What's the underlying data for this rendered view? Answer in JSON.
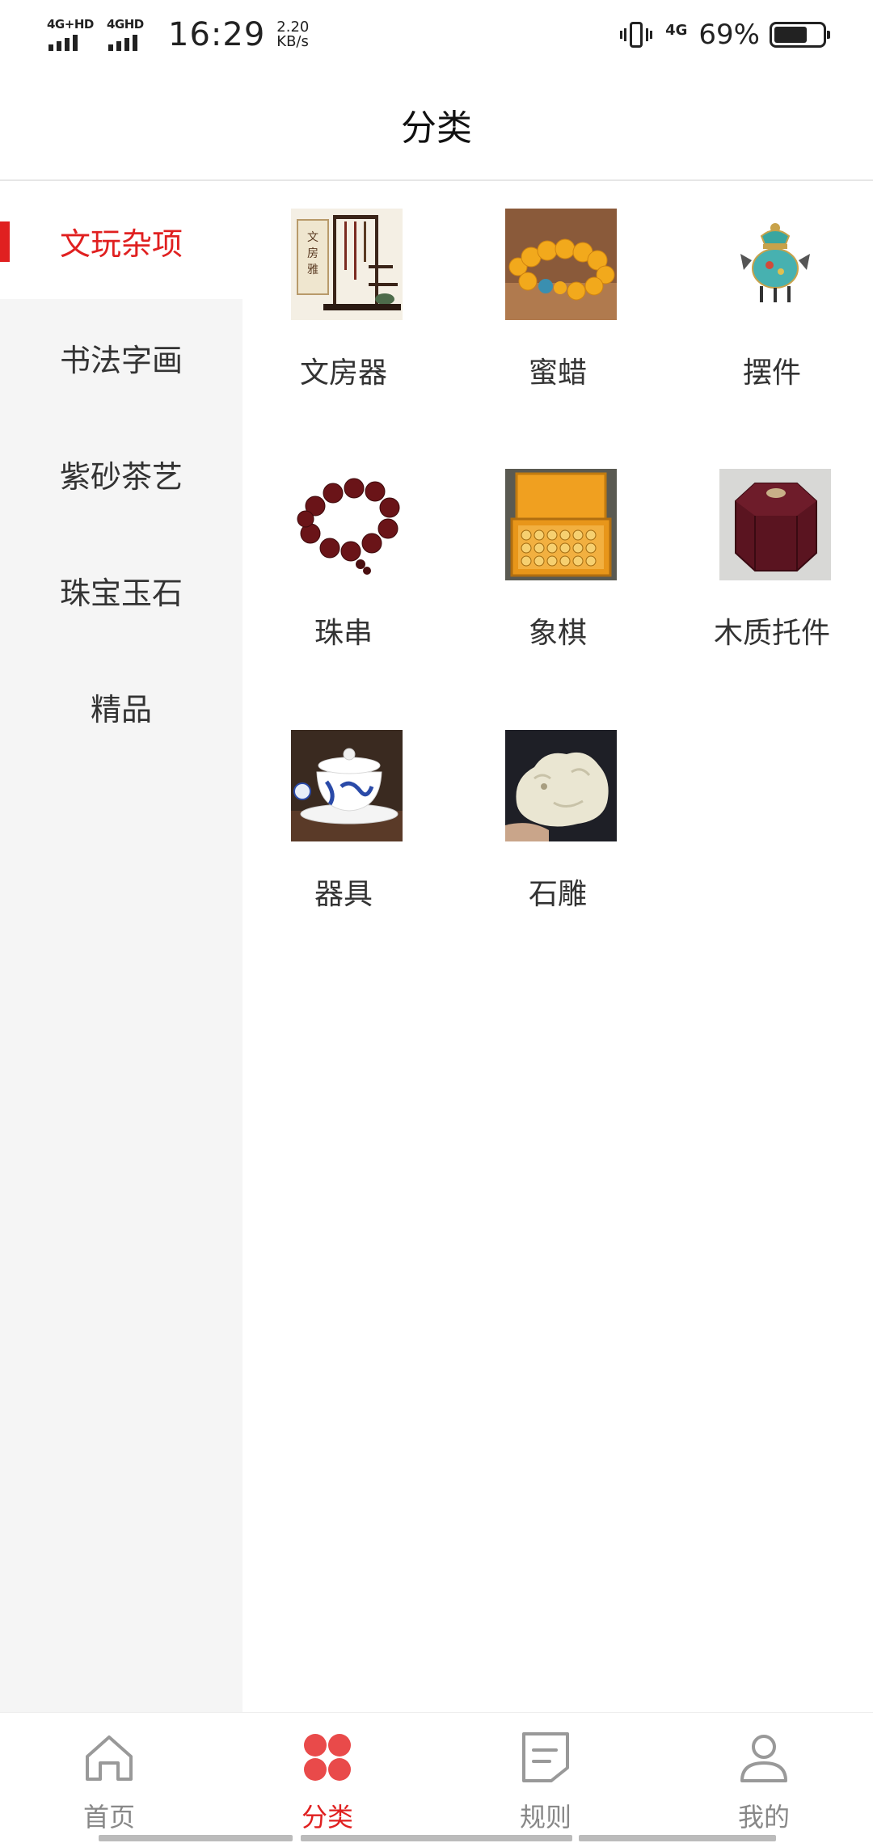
{
  "status_bar": {
    "sim1": "4G+HD",
    "sim2": "4GHD",
    "time": "16:29",
    "speed_value": "2.20",
    "speed_unit": "KB/s",
    "data_net": "4G",
    "battery_pct": "69%",
    "battery_level": 0.69
  },
  "header": {
    "title": "分类"
  },
  "sidebar": {
    "items": [
      {
        "label": "文玩杂项",
        "active": true
      },
      {
        "label": "书法字画",
        "active": false
      },
      {
        "label": "紫砂茶艺",
        "active": false
      },
      {
        "label": "珠宝玉石",
        "active": false
      },
      {
        "label": "精品",
        "active": false
      }
    ]
  },
  "grid": {
    "items": [
      {
        "label": "文房器",
        "icon": "brush-rack-image"
      },
      {
        "label": "蜜蜡",
        "icon": "amber-bracelet-image"
      },
      {
        "label": "摆件",
        "icon": "cloisonne-censer-image"
      },
      {
        "label": "珠串",
        "icon": "bead-bracelet-image"
      },
      {
        "label": "象棋",
        "icon": "chess-set-image"
      },
      {
        "label": "木质托件",
        "icon": "wooden-box-image"
      },
      {
        "label": "器具",
        "icon": "teacup-image"
      },
      {
        "label": "石雕",
        "icon": "jade-carving-image"
      }
    ]
  },
  "bottom_nav": {
    "items": [
      {
        "label": "首页",
        "icon": "home-icon",
        "active": false
      },
      {
        "label": "分类",
        "icon": "category-icon",
        "active": true
      },
      {
        "label": "规则",
        "icon": "rules-icon",
        "active": false
      },
      {
        "label": "我的",
        "icon": "profile-icon",
        "active": false
      }
    ]
  },
  "colors": {
    "accent": "#e02020",
    "sidebar_bg": "#f5f5f5",
    "inactive_text": "#888888"
  }
}
